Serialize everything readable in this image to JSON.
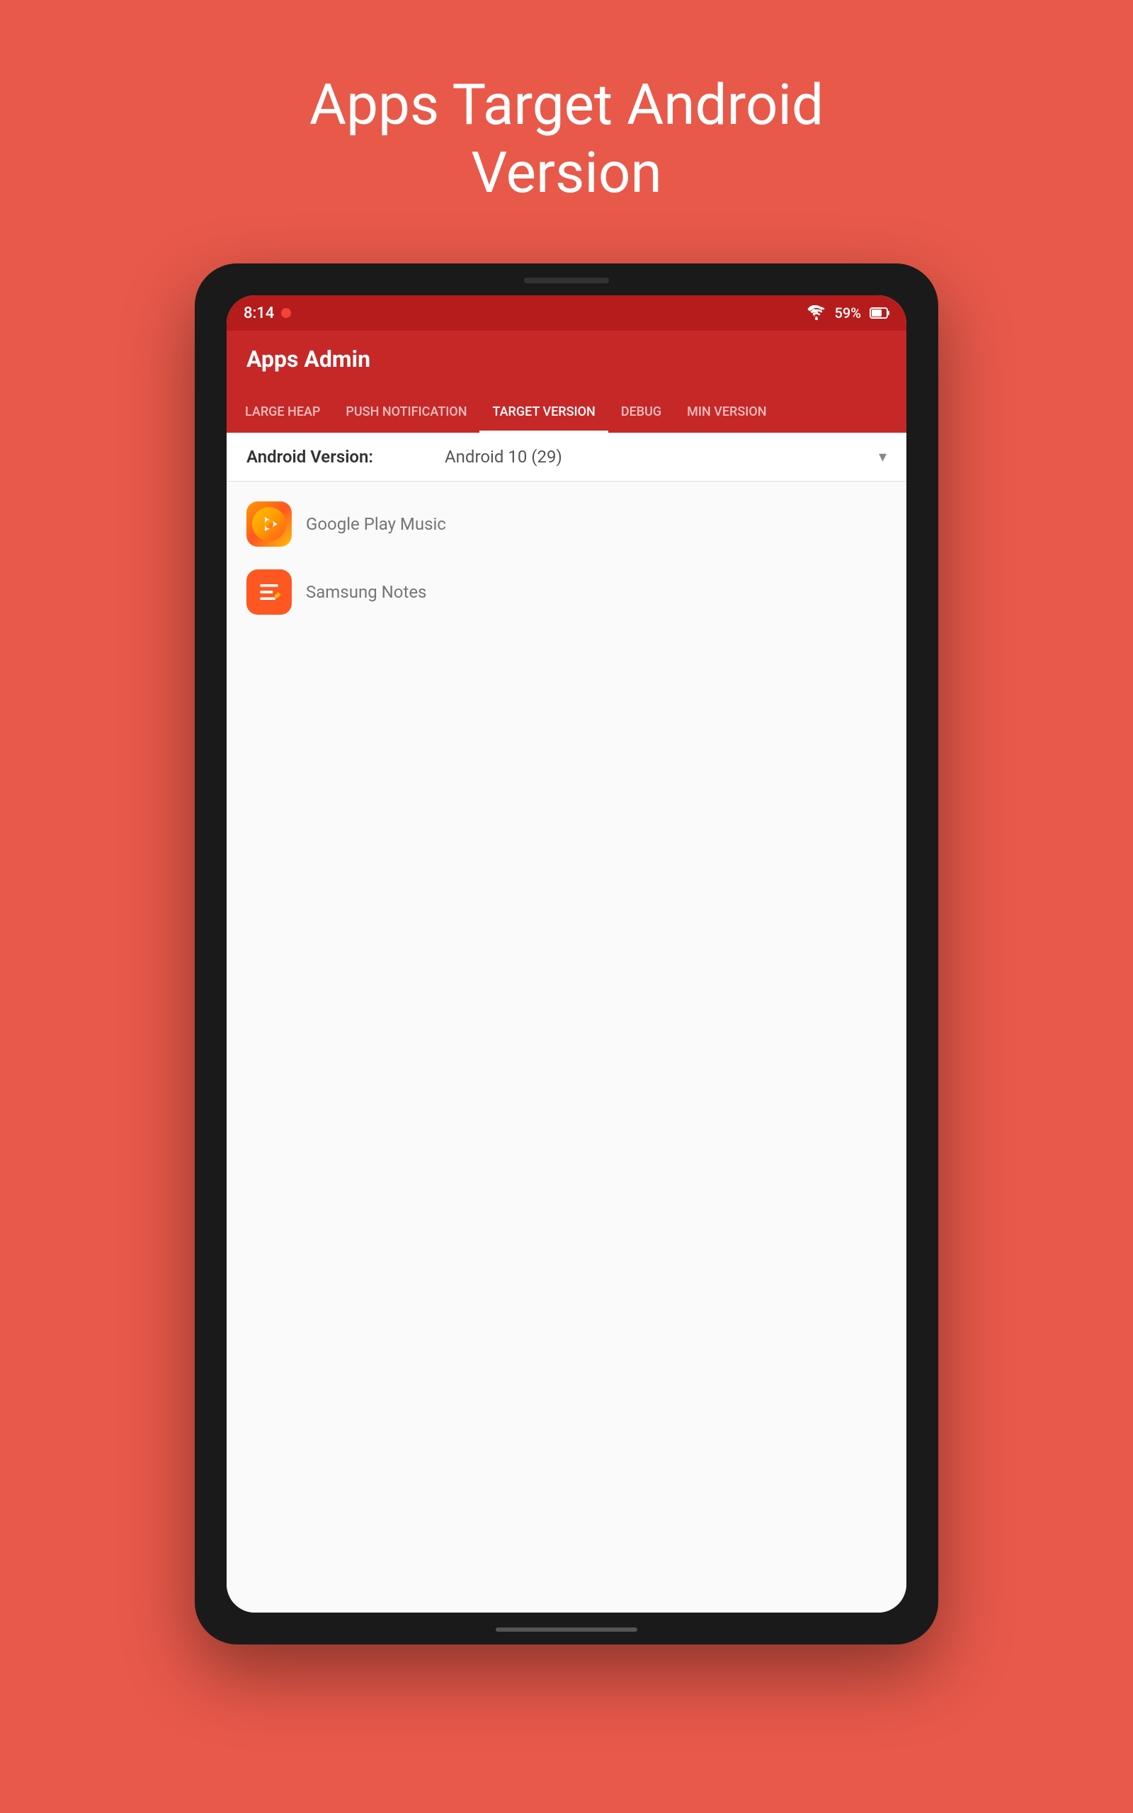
{
  "page": {
    "title": "Apps Target Android\nVersion",
    "background_color": "#e8594a"
  },
  "status_bar": {
    "time": "8:14",
    "battery": "59%",
    "wifi_icon": "wifi",
    "battery_icon": "battery",
    "record_icon": "record"
  },
  "app_bar": {
    "title": "Apps Admin"
  },
  "tabs": [
    {
      "id": "large-heap",
      "label": "LARGE HEAP",
      "active": false
    },
    {
      "id": "push-notification",
      "label": "PUSH NOTIFICATION",
      "active": false
    },
    {
      "id": "target-version",
      "label": "TARGET VERSION",
      "active": true
    },
    {
      "id": "debug",
      "label": "DEBUG",
      "active": false
    },
    {
      "id": "min-version",
      "label": "MIN VERSION",
      "active": false
    }
  ],
  "version_selector": {
    "label": "Android Version:",
    "value": "Android 10 (29)"
  },
  "apps": [
    {
      "id": "google-play-music",
      "name": "Google Play Music",
      "icon_type": "play-music"
    },
    {
      "id": "samsung-notes",
      "name": "Samsung Notes",
      "icon_type": "samsung-notes"
    }
  ]
}
